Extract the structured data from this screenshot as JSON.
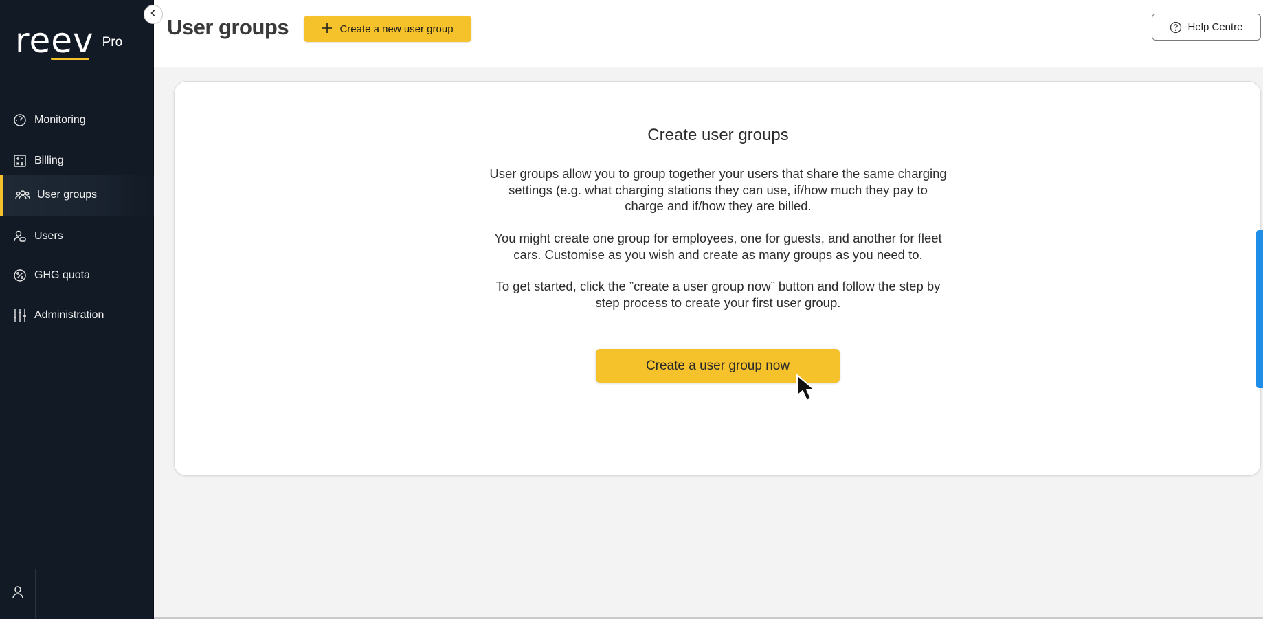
{
  "brand": {
    "name": "reev",
    "tier": "Pro",
    "accent_color": "#f5c22c",
    "sidebar_color": "#121a25"
  },
  "sidebar": {
    "items": [
      {
        "label": "Monitoring",
        "icon": "speedometer-icon"
      },
      {
        "label": "Billing",
        "icon": "calculator-icon"
      },
      {
        "label": "User groups",
        "icon": "user-group-icon",
        "active": true
      },
      {
        "label": "Users",
        "icon": "users-icon"
      },
      {
        "label": "GHG quota",
        "icon": "percent-badge-icon"
      },
      {
        "label": "Administration",
        "icon": "sliders-icon"
      }
    ],
    "collapse_icon": "chevron-left-icon",
    "account_icon": "user-icon"
  },
  "header": {
    "title": "User groups",
    "new_group_label": "Create a new user group",
    "help_label": "Help Centre",
    "help_icon": "question-circle-icon"
  },
  "main": {
    "title": "Create user groups",
    "paragraph_1": "User groups allow you to group together your users that share the same charging settings (e.g. what charging stations they can use, if/how much they pay to charge and if/how they are billed.",
    "paragraph_2": "You might create one group for employees, one for guests, and another for fleet cars. Customise as you wish and create as many groups as you need to.",
    "paragraph_3": "To get started, click the ”create a user group now” button and follow the step by step process to create your first user group.",
    "cta_label": "Create a user group now"
  }
}
